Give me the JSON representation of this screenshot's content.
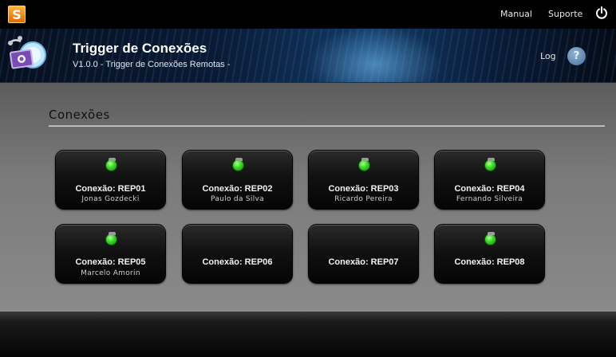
{
  "topbar": {
    "manual_label": "Manual",
    "suporte_label": "Suporte",
    "logo_letter": "S"
  },
  "header": {
    "title": "Trigger de Conexões",
    "subtitle": "V1.0.0 - Trigger de Conexões Remotas -",
    "log_label": "Log",
    "help_label": "?"
  },
  "section": {
    "title": "Conexões"
  },
  "connections": [
    {
      "name": "Conexão: REP01",
      "user": "Jonas Gozdecki",
      "online": true
    },
    {
      "name": "Conexão: REP02",
      "user": "Paulo da Silva",
      "online": true
    },
    {
      "name": "Conexão: REP03",
      "user": "Ricardo Pereira",
      "online": true
    },
    {
      "name": "Conexão: REP04",
      "user": "Fernando Silveira",
      "online": true
    },
    {
      "name": "Conexão: REP05",
      "user": "Marcelo Amorin",
      "online": true
    },
    {
      "name": "Conexão: REP06",
      "user": "",
      "online": false
    },
    {
      "name": "Conexão: REP07",
      "user": "",
      "online": false
    },
    {
      "name": "Conexão: REP08",
      "user": "",
      "online": true
    }
  ],
  "colors": {
    "status_online": "#3edc2a",
    "accent_help": "#5a7fa8"
  }
}
